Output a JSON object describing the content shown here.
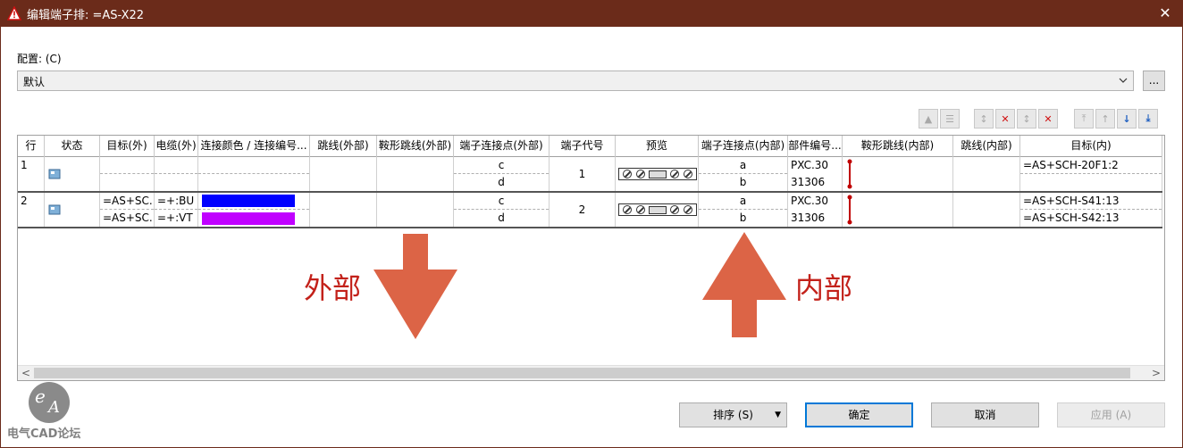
{
  "window": {
    "title": "编辑端子排: =AS-X22",
    "close_label": "✕"
  },
  "config": {
    "label": "配置: (C)",
    "selected": "默认",
    "more_label": "..."
  },
  "columns": [
    "行",
    "状态",
    "目标(外)",
    "电缆(外)",
    "连接颜色 / 连接编号...",
    "跳线(外部)",
    "鞍形跳线(外部)",
    "端子连接点(外部)",
    "端子代号",
    "预览",
    "端子连接点(内部)",
    "部件编号...",
    "鞍形跳线(内部)",
    "跳线(内部)",
    "目标(内)"
  ],
  "rows": [
    {
      "row": "1",
      "target_out": [
        "",
        ""
      ],
      "cable_out": [
        "",
        ""
      ],
      "colors": [
        "",
        ""
      ],
      "conn_out": [
        "c",
        "d"
      ],
      "terminal": "1",
      "conn_in": [
        "a",
        "b"
      ],
      "part": [
        "PXC.30",
        "31306"
      ],
      "target_in": [
        "=AS+SCH-20F1:2",
        ""
      ]
    },
    {
      "row": "2",
      "target_out": [
        "=AS+SC...",
        "=AS+SC..."
      ],
      "cable_out": [
        "=+:BU",
        "=+:VT"
      ],
      "colors": [
        "#0000ff",
        "#c000ff"
      ],
      "conn_out": [
        "c",
        "d"
      ],
      "terminal": "2",
      "conn_in": [
        "a",
        "b"
      ],
      "part": [
        "PXC.30",
        "31306"
      ],
      "target_in": [
        "=AS+SCH-S41:13",
        "=AS+SCH-S42:13"
      ]
    }
  ],
  "annotations": {
    "outer": "外部",
    "inner": "内部",
    "arrow_color": "#dc6446"
  },
  "buttons": {
    "sort": "排序 (S)",
    "ok": "确定",
    "cancel": "取消",
    "apply": "应用 (A)"
  },
  "watermark": {
    "text": "电气CAD论坛"
  },
  "colors": {
    "titlebar": "#6b2b1a",
    "accent": "#0078d7",
    "jumper": "#c00000"
  }
}
